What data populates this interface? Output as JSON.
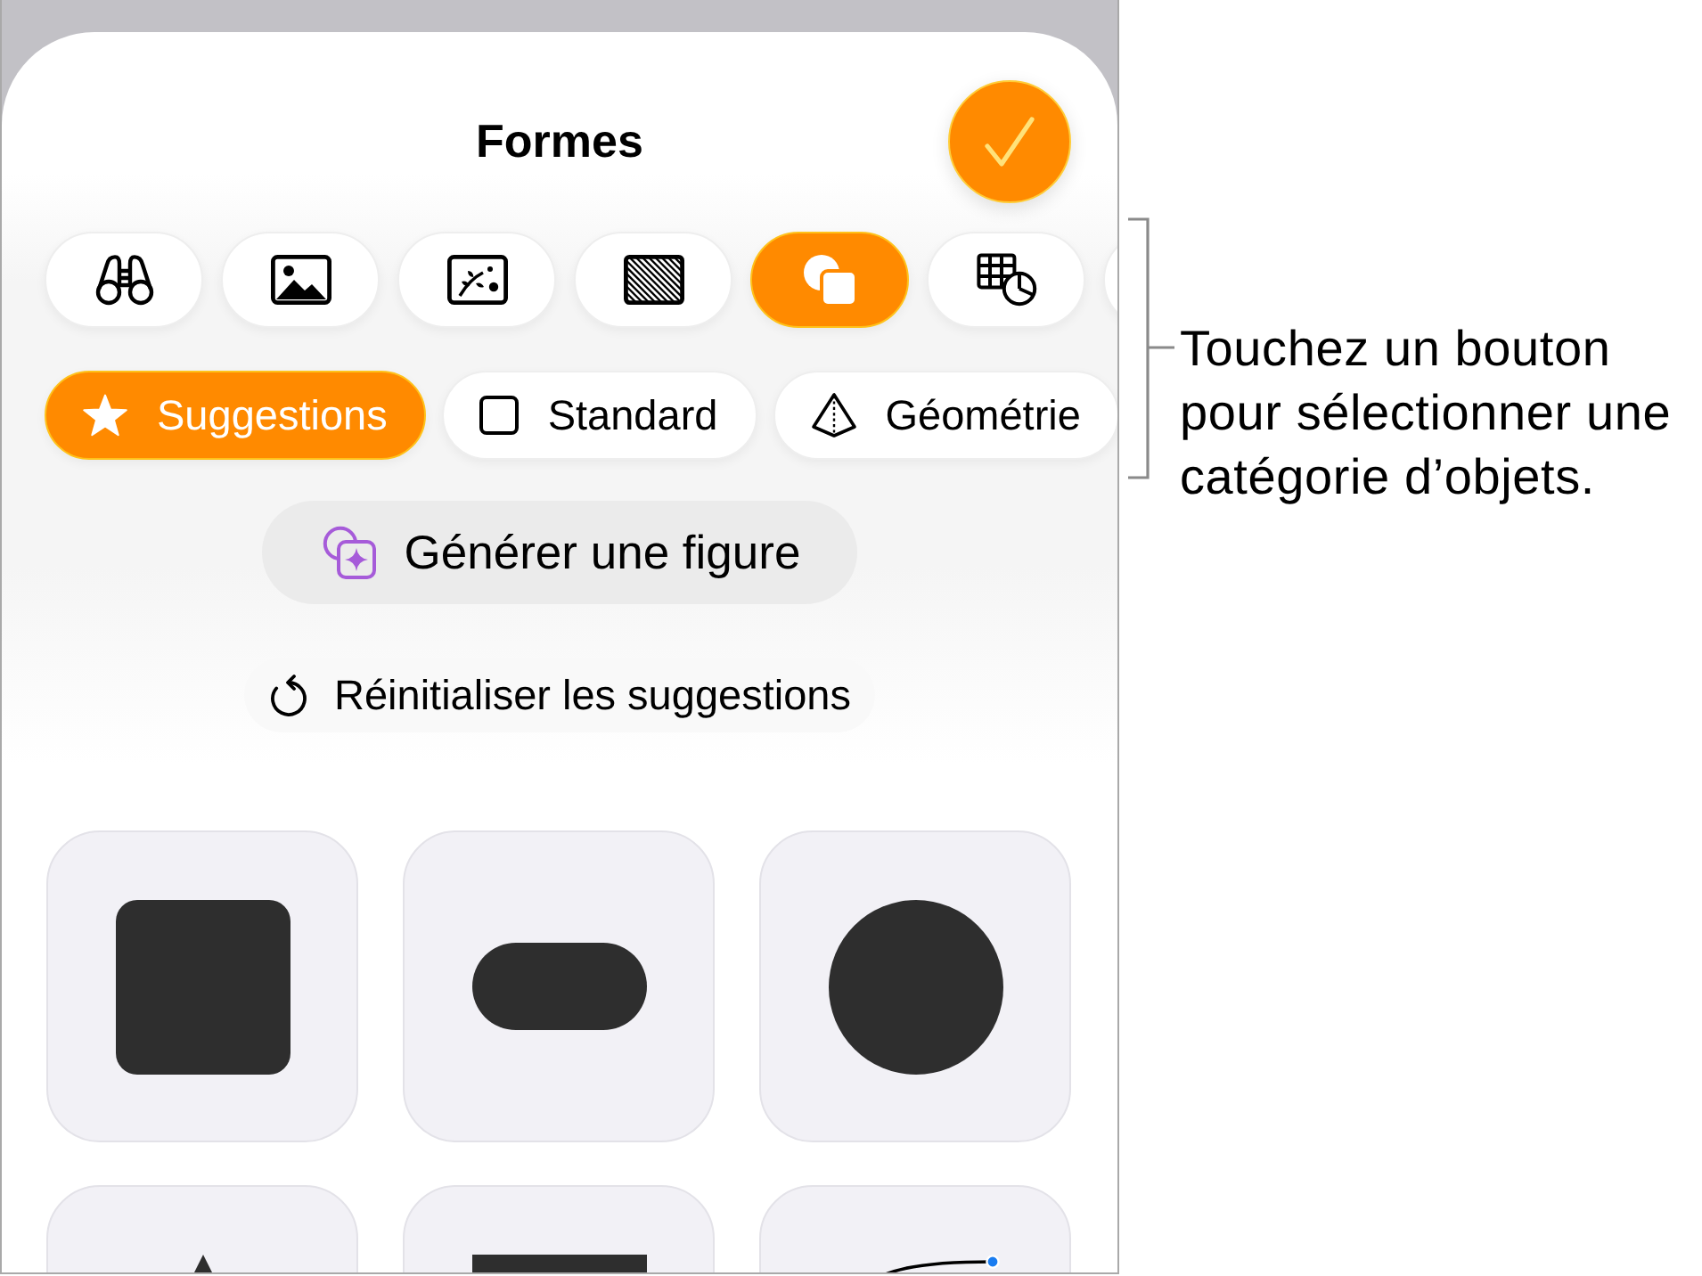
{
  "sheet": {
    "title": "Formes"
  },
  "categories": [
    {
      "kind": "binoculars",
      "selected": false
    },
    {
      "kind": "photo",
      "selected": false
    },
    {
      "kind": "media",
      "selected": false
    },
    {
      "kind": "texture",
      "selected": false
    },
    {
      "kind": "shapes",
      "selected": true
    },
    {
      "kind": "table_chart",
      "selected": false
    },
    {
      "kind": "cut_off",
      "selected": false
    }
  ],
  "subcategories": [
    {
      "label": "Suggestions",
      "kind": "star",
      "selected": true
    },
    {
      "label": "Standard",
      "kind": "square",
      "selected": false
    },
    {
      "label": "Géométrie",
      "kind": "pyramid",
      "selected": false
    }
  ],
  "generate_button": {
    "label": "Générer une figure"
  },
  "reset_button": {
    "label": "Réinitialiser les suggestions"
  },
  "shapes": [
    {
      "kind": "rounded_square"
    },
    {
      "kind": "capsule"
    },
    {
      "kind": "circle"
    },
    {
      "kind": "triangle"
    },
    {
      "kind": "rectangle"
    },
    {
      "kind": "curve"
    }
  ],
  "callout": {
    "lines": [
      "Touchez un bouton",
      "pour sélectionner une",
      "catégorie d’objets."
    ]
  }
}
